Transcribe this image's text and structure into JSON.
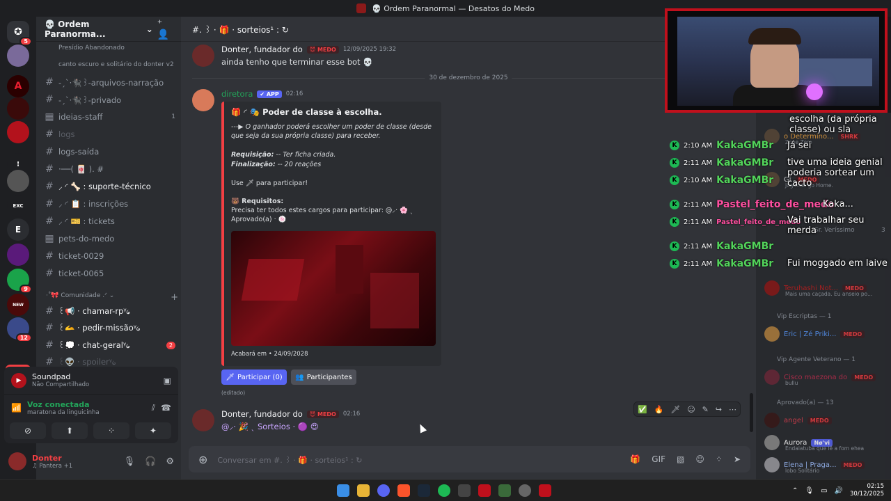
{
  "window_title": "💀 Ordem Paranormal — Desatos do Medo",
  "server": {
    "name": "💀 Ordem Paranorma...",
    "chevron": "⌄"
  },
  "threads": [
    "Presídio Abandonado",
    "canto escuro e solitário do donter v2"
  ],
  "channels": [
    {
      "name": "-ˏˋ·🐈‍⬛꒱-arquivos-narração",
      "icon": "#",
      "style": "normal"
    },
    {
      "name": "-ˏˋ·🐈‍⬛꒱-privado",
      "icon": "#",
      "style": "normal"
    },
    {
      "name": "ideias-staff",
      "icon": "#",
      "style": "normal",
      "count": "1"
    },
    {
      "name": "logs",
      "icon": "#",
      "style": "muted"
    },
    {
      "name": "logs-saída",
      "icon": "#",
      "style": "normal"
    },
    {
      "name": "·──( 🀄 ). #",
      "icon": "#",
      "style": "normal"
    },
    {
      "name": "⸝ ◜ 🦴 : suporte-técnico",
      "icon": "#",
      "style": "bright"
    },
    {
      "name": "⸝ ◜ 📋 : inscrições",
      "icon": "#",
      "style": "normal"
    },
    {
      "name": "⸝ ◜ 🎫 : tickets",
      "icon": "#",
      "style": "normal"
    },
    {
      "name": "pets-do-medo",
      "icon": "#",
      "style": "normal"
    },
    {
      "name": "ticket-0029",
      "icon": "#",
      "style": "normal"
    },
    {
      "name": "ticket-0065",
      "icon": "#",
      "style": "normal"
    }
  ],
  "category": {
    "name": "·˚🎀 Comunidade .ᐟ ⌄",
    "plus": "+"
  },
  "community_channels": [
    {
      "name": "꒰📢 · chamar-rpᵞ᥀",
      "style": "bright"
    },
    {
      "name": "꒰🫴 · pedir-missãoᵞ᥀",
      "style": "bright"
    },
    {
      "name": "꒰💭 · chat-geralᵞ᥀",
      "style": "bright",
      "badge": "2"
    },
    {
      "name": "꒰👽 · spoilerᵞ᥀",
      "style": "muted"
    }
  ],
  "guild_badges": {
    "dm": "5",
    "badge2": "9",
    "badge3": "12"
  },
  "novo_label": "NOVO",
  "soundpad": {
    "title": "Soundpad",
    "subtitle": "Não Compartilhado"
  },
  "voice": {
    "title": "Voz conectada",
    "subtitle": "maratona da linguicinha"
  },
  "user": {
    "name": "Donter",
    "status": "♫ Pantera +1"
  },
  "chat": {
    "channel_title": "#. ꒱ · 🎁 · sorteios¹ : ↻",
    "msg1": {
      "author": "Donter, fundador do",
      "tag": "😈 MEDO",
      "time": "12/09/2025 19:32",
      "text": "ainda tenho que terminar esse bot 💀"
    },
    "date_divider": "30 de dezembro de 2025",
    "msg2": {
      "author": "diretora",
      "app": "✔ APP",
      "time": "02:16"
    },
    "embed": {
      "title": "🎁 ◜ 🎭 Poder de classe à escolha.",
      "line1": "---▶ O ganhador poderá escolher um poder de classe (desde que seja da sua própria classe) para receber.",
      "req_label": "Requisição:",
      "req_value": "-- Ter ficha criada.",
      "fin_label": "Finalização:",
      "fin_value": "-- 20 reações",
      "use": "Use 🗡 para participar!",
      "requisitos_title": "🐻 Requisitos:",
      "requisitos_text": "Precisa ter todos estes cargos para participar: @⸝· 🌸 ˎ Aprovado(a) · 🍥",
      "footer": "Acabará em • 24/09/2028"
    },
    "participate_button": "Participar (0)",
    "participants_button": "Participantes",
    "edited": "(editado)",
    "msg3": {
      "author": "Donter, fundador do",
      "tag": "😈 MEDO",
      "time": "02:16",
      "text": "@⸝· 🎉 ˎ Sorteios · 🟣 😍"
    },
    "composer_placeholder": "Conversar em #. ꒱ · 🎁 · sorteios¹ : ↻"
  },
  "overlay_chat": [
    {
      "time": "2:10 AM",
      "name": "KakaGMBr",
      "color": "#52d35a",
      "msg": "escolha (da própria classe) ou sla"
    },
    {
      "time": "2:10 AM",
      "name": "KakaGMBr",
      "color": "#52d35a",
      "msg": "Já sei"
    },
    {
      "time": "2:11 AM",
      "name": "KakaGMBr",
      "color": "#52d35a",
      "msg": "tive uma ideia genial poderia sortear um cacto"
    },
    {
      "time": "2:11 AM",
      "name": "Pastel_feito_de_medo",
      "color": "#ff4fa0",
      "msg": "Kaka..."
    },
    {
      "time": "2:11 AM",
      "name": "Pastel_feito_de_medo",
      "color": "#ff4fa0",
      "msg": "Vai trabalhar seu merda"
    },
    {
      "time": "2:11 AM",
      "name": "KakaGMBr",
      "color": "#52d35a",
      "msg": ""
    },
    {
      "time": "2:11 AM",
      "name": "KakaGMBr",
      "color": "#52d35a",
      "msg": "Fui moggado em laive"
    }
  ],
  "members": {
    "m1": {
      "name": "o Determino...",
      "tag": "SHRK",
      "sub": "Zone Zero"
    },
    "m2": {
      "name": "Gi",
      "tag": "MEDO",
      "sub": "Jogando go Home."
    },
    "m3": {
      "name": "Sr. Veríssimo",
      "count": "3"
    },
    "m4": {
      "name": "Teruhashi Not...",
      "tag": "MEDO",
      "sub": "Mais uma caçada. Eu anseio po..."
    },
    "cat1": "Vip Escriptas — 1",
    "m5": {
      "name": "Eric | Zé Priki...",
      "tag": "MEDO"
    },
    "cat2": "Vip Agente Veterano — 1",
    "m6": {
      "name": "Cisco maezona do",
      "tag": "MEDO",
      "sub": "bullu"
    },
    "cat3": "Aprovado(a) — 13",
    "m7": {
      "name": "angel",
      "tag": "MEDO"
    },
    "m8": {
      "name": "Aurora",
      "tag": "Nø'vi",
      "sub": "Endaiatuba que lê a fom ehea"
    },
    "m9": {
      "name": "Elena | Praga...",
      "tag": "MEDO",
      "sub": "lobo Solitário"
    }
  },
  "clock": {
    "time": "02:15",
    "date": "30/12/2025"
  },
  "colors": {
    "accent": "#5865f2",
    "danger": "#f23f43",
    "online": "#23a55a"
  }
}
